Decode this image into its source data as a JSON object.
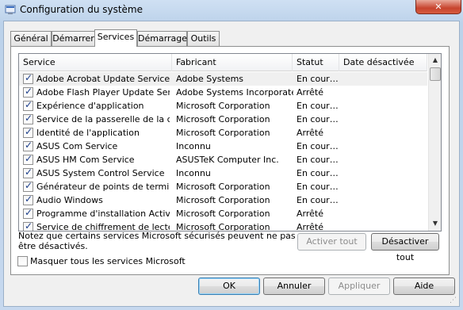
{
  "window": {
    "title": "Configuration du système",
    "close_label": "✕"
  },
  "tabs": [
    {
      "label": "Général",
      "active": false
    },
    {
      "label": "Démarrer",
      "active": false
    },
    {
      "label": "Services",
      "active": true
    },
    {
      "label": "Démarrage",
      "active": false
    },
    {
      "label": "Outils",
      "active": false
    }
  ],
  "columns": {
    "service": "Service",
    "manufacturer": "Fabricant",
    "status": "Statut",
    "disabled_date": "Date désactivée"
  },
  "services": [
    {
      "checked": true,
      "name": "Adobe Acrobat Update Service",
      "manufacturer": "Adobe Systems",
      "status": "En cour…",
      "date": ""
    },
    {
      "checked": true,
      "name": "Adobe Flash Player Update Service",
      "manufacturer": "Adobe Systems Incorporated",
      "status": "Arrêté",
      "date": ""
    },
    {
      "checked": true,
      "name": "Expérience d'application",
      "manufacturer": "Microsoft Corporation",
      "status": "En cour…",
      "date": ""
    },
    {
      "checked": true,
      "name": "Service de la passerelle de la co…",
      "manufacturer": "Microsoft Corporation",
      "status": "En cour…",
      "date": ""
    },
    {
      "checked": true,
      "name": "Identité de l'application",
      "manufacturer": "Microsoft Corporation",
      "status": "Arrêté",
      "date": ""
    },
    {
      "checked": true,
      "name": "ASUS Com Service",
      "manufacturer": "Inconnu",
      "status": "En cour…",
      "date": ""
    },
    {
      "checked": true,
      "name": "ASUS HM Com Service",
      "manufacturer": "ASUSTeK Computer Inc.",
      "status": "En cour…",
      "date": ""
    },
    {
      "checked": true,
      "name": "ASUS System Control Service",
      "manufacturer": "Inconnu",
      "status": "En cour…",
      "date": ""
    },
    {
      "checked": true,
      "name": "Générateur de points de termina…",
      "manufacturer": "Microsoft Corporation",
      "status": "En cour…",
      "date": ""
    },
    {
      "checked": true,
      "name": "Audio Windows",
      "manufacturer": "Microsoft Corporation",
      "status": "En cour…",
      "date": ""
    },
    {
      "checked": true,
      "name": "Programme d'installation ActiveX…",
      "manufacturer": "Microsoft Corporation",
      "status": "Arrêté",
      "date": ""
    },
    {
      "checked": true,
      "name": "Service de chiffrement de lecteu…",
      "manufacturer": "Microsoft Corporation",
      "status": "Arrêté",
      "date": ""
    }
  ],
  "note": "Notez que certains services Microsoft sécurisés peuvent ne pas être désactivés.",
  "buttons": {
    "enable_all": "Activer tout",
    "disable_all": "Désactiver tout",
    "ok": "OK",
    "cancel": "Annuler",
    "apply": "Appliquer",
    "help": "Aide"
  },
  "hide_ms": {
    "label": "Masquer tous les services Microsoft",
    "checked": false
  },
  "colors": {
    "title_bar": "#c6d8ee",
    "close": "#c7442e"
  }
}
